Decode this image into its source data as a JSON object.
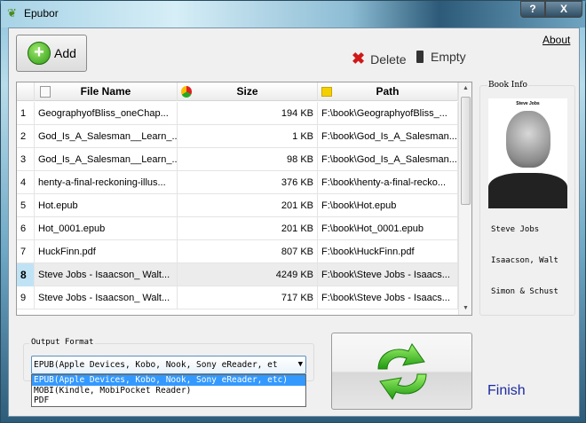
{
  "window": {
    "title": "Epubor",
    "help_label": "?",
    "close_label": "X"
  },
  "toolbar": {
    "add_label": "Add",
    "about_label": "About",
    "delete_label": "Delete",
    "empty_label": "Empty"
  },
  "table": {
    "headers": {
      "file_name": "File Name",
      "size": "Size",
      "path": "Path"
    },
    "rows": [
      {
        "n": "1",
        "file": "GeographyofBliss_oneChap...",
        "size": "194 KB",
        "path": "F:\\book\\GeographyofBliss_..."
      },
      {
        "n": "2",
        "file": "God_Is_A_Salesman__Learn_...",
        "size": "1 KB",
        "path": "F:\\book\\God_Is_A_Salesman..."
      },
      {
        "n": "3",
        "file": "God_Is_A_Salesman__Learn_...",
        "size": "98 KB",
        "path": "F:\\book\\God_Is_A_Salesman..."
      },
      {
        "n": "4",
        "file": "henty-a-final-reckoning-illus...",
        "size": "376 KB",
        "path": "F:\\book\\henty-a-final-recko..."
      },
      {
        "n": "5",
        "file": "Hot.epub",
        "size": "201 KB",
        "path": "F:\\book\\Hot.epub"
      },
      {
        "n": "6",
        "file": "Hot_0001.epub",
        "size": "201 KB",
        "path": "F:\\book\\Hot_0001.epub"
      },
      {
        "n": "7",
        "file": "HuckFinn.pdf",
        "size": "807 KB",
        "path": "F:\\book\\HuckFinn.pdf"
      },
      {
        "n": "8",
        "file": "Steve Jobs - Isaacson_ Walt...",
        "size": "4249 KB",
        "path": "F:\\book\\Steve Jobs - Isaacs...",
        "selected": true
      },
      {
        "n": "9",
        "file": "Steve Jobs - Isaacson_ Walt...",
        "size": "717 KB",
        "path": "F:\\book\\Steve Jobs - Isaacs..."
      }
    ]
  },
  "book_info": {
    "title": "Book Info",
    "cover_caption": "Steve Jobs",
    "book_title": "Steve Jobs",
    "author": "Isaacson, Walt",
    "publisher": "Simon & Schust"
  },
  "output_format": {
    "title": "Output Format",
    "selected": "EPUB(Apple Devices, Kobo, Nook, Sony eReader, et",
    "options": [
      "EPUB(Apple Devices, Kobo, Nook, Sony eReader, etc)",
      "MOBI(Kindle, MobiPocket Reader)",
      "PDF"
    ]
  },
  "finish_label": "Finish"
}
